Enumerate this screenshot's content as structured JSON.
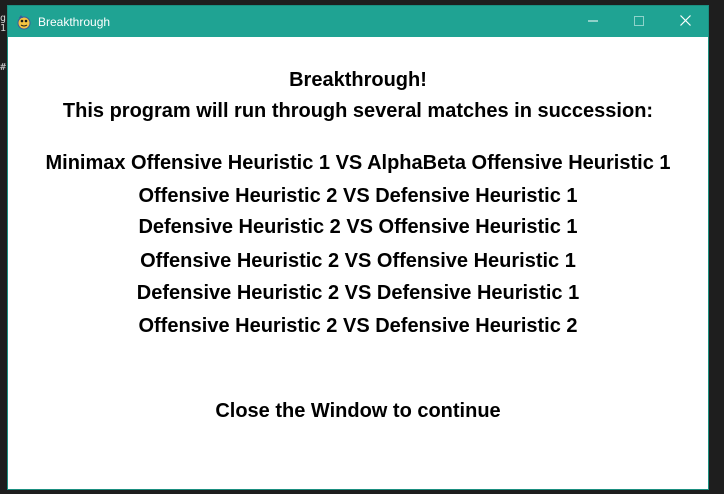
{
  "window": {
    "title": "Breakthrough",
    "icon": "pygame-snake-icon",
    "titlebar_color": "#1fa393"
  },
  "controls": {
    "minimize_icon": "minimize-icon",
    "maximize_icon": "maximize-icon",
    "close_icon": "close-icon"
  },
  "background": {
    "chars": [
      "g",
      "1"
    ],
    "hash": "#"
  },
  "content": {
    "heading": "Breakthrough!",
    "subheading": "This program will run through several matches in succession:",
    "matches": [
      "Minimax Offensive Heuristic 1 VS AlphaBeta Offensive Heuristic 1",
      "Offensive Heuristic 2 VS Defensive Heuristic 1",
      "Defensive Heuristic 2 VS Offensive Heuristic 1",
      "Offensive Heuristic 2 VS Offensive Heuristic 1",
      "Defensive Heuristic 2 VS Defensive Heuristic 1",
      "Offensive Heuristic 2 VS Defensive Heuristic 2"
    ],
    "footer": "Close the Window to continue"
  }
}
